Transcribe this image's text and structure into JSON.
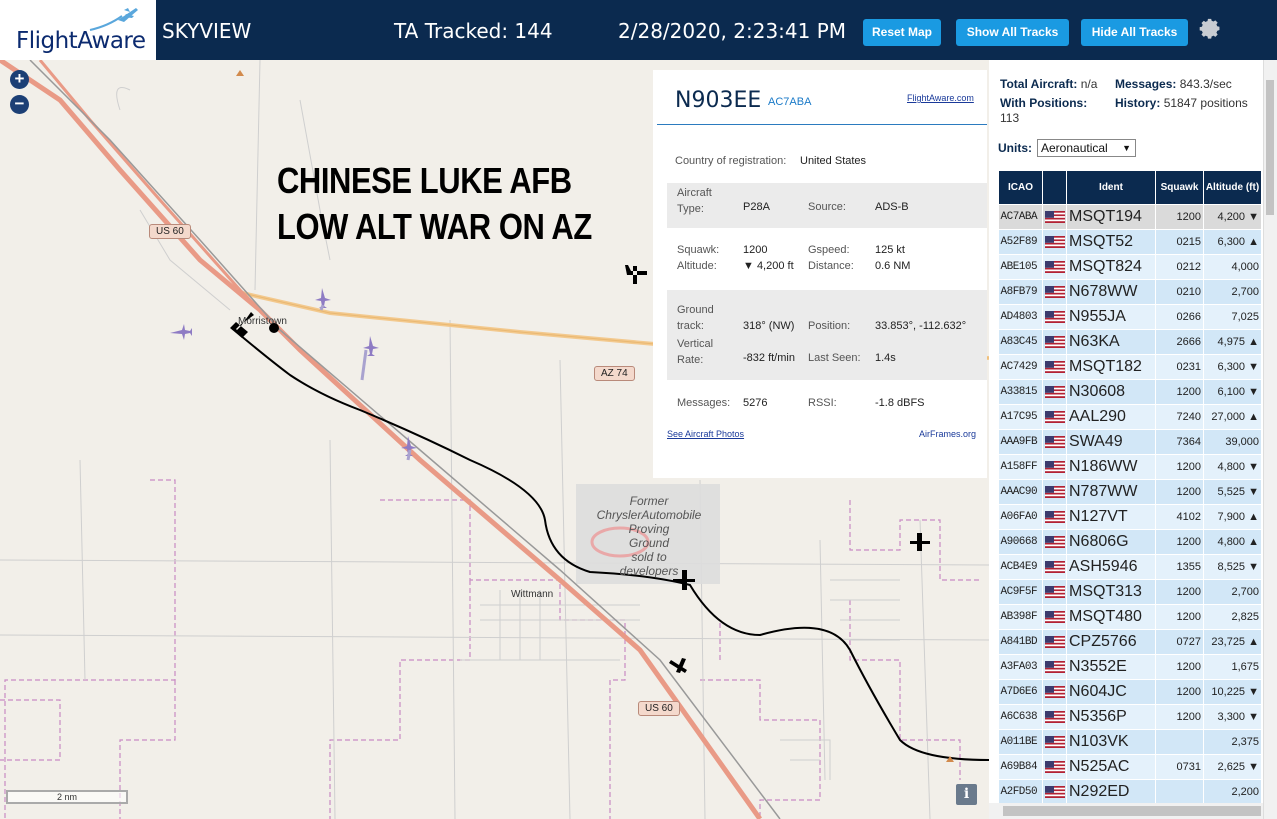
{
  "header": {
    "logo": "FlightAware",
    "app_title": "SKYVIEW",
    "ta_tracked": "TA Tracked: 144",
    "clock": "2/28/2020, 2:23:41 PM",
    "buttons": {
      "reset": "Reset Map",
      "show": "Show All Tracks",
      "hide": "Hide All Tracks"
    },
    "colors": {
      "header_bg": "#0b2a4f",
      "button_bg": "#1a9ae2"
    }
  },
  "map": {
    "zoom_in": "+",
    "zoom_out": "−",
    "overlay_text": [
      "CHINESE LUKE AFB",
      "LOW ALT WAR ON AZ"
    ],
    "place_labels": {
      "morristown": "Morristown",
      "wittmann": "Wittmann"
    },
    "roads": {
      "us60_a": "US 60",
      "us60_b": "US 60",
      "az74": "AZ 74"
    },
    "chrysler": [
      "Former",
      "ChryslerAutomobile",
      "Proving",
      "Ground",
      "sold to",
      "developers"
    ],
    "scale": "2 nm",
    "info": "i"
  },
  "detail": {
    "registration": "N903EE",
    "icao": "AC7ABA",
    "fa_link": "FlightAware.com",
    "country_label": "Country of registration:",
    "country": "United States",
    "aircraft_type_label": [
      "Aircraft",
      "Type:"
    ],
    "aircraft_type": "P28A",
    "source_label": "Source:",
    "source": "ADS-B",
    "squawk_label": "Squawk:",
    "squawk": "1200",
    "gspeed_label": "Gspeed:",
    "gspeed": "125 kt",
    "altitude_label": "Altitude:",
    "altitude": "▼ 4,200 ft",
    "distance_label": "Distance:",
    "distance": "0.6 NM",
    "track_label": [
      "Ground",
      "track:"
    ],
    "track": "318° (NW)",
    "position_label": "Position:",
    "position": "33.853°, -112.632°",
    "vrate_label": [
      "Vertical",
      "Rate:"
    ],
    "vrate": "-832 ft/min",
    "lastseen_label": "Last Seen:",
    "lastseen": "1.4s",
    "messages_label": "Messages:",
    "messages": "5276",
    "rssi_label": "RSSI:",
    "rssi": "-1.8 dBFS",
    "photos_link": "See Aircraft Photos",
    "airframes_link": "AirFrames.org"
  },
  "sidebar": {
    "total_label": "Total Aircraft:",
    "total": "n/a",
    "messages_label": "Messages:",
    "messages": "843.3/sec",
    "withpos_label": "With Positions:",
    "withpos": "113",
    "history_label": "History:",
    "history": "51847 positions",
    "units_label": "Units:",
    "units_value": "Aeronautical",
    "columns": [
      "ICAO",
      "",
      "Ident",
      "Squawk",
      "Altitude (ft)"
    ],
    "rows": [
      [
        "AC7ABA",
        "MSQT194",
        "1200",
        "4,200 ▼"
      ],
      [
        "A52F89",
        "MSQT52",
        "0215",
        "6,300 ▲"
      ],
      [
        "ABE105",
        "MSQT824",
        "0212",
        "4,000"
      ],
      [
        "A8FB79",
        "N678WW",
        "0210",
        "2,700"
      ],
      [
        "AD4803",
        "N955JA",
        "0266",
        "7,025"
      ],
      [
        "A83C45",
        "N63KA",
        "2666",
        "4,975 ▲"
      ],
      [
        "AC7429",
        "MSQT182",
        "0231",
        "6,300 ▼"
      ],
      [
        "A33815",
        "N30608",
        "1200",
        "6,100 ▼"
      ],
      [
        "A17C95",
        "AAL290",
        "7240",
        "27,000 ▲"
      ],
      [
        "AAA9FB",
        "SWA49",
        "7364",
        "39,000"
      ],
      [
        "A158FF",
        "N186WW",
        "1200",
        "4,800 ▼"
      ],
      [
        "AAAC90",
        "N787WW",
        "1200",
        "5,525 ▼"
      ],
      [
        "A06FA0",
        "N127VT",
        "4102",
        "7,900 ▲"
      ],
      [
        "A90668",
        "N6806G",
        "1200",
        "4,800 ▲"
      ],
      [
        "ACB4E9",
        "ASH5946",
        "1355",
        "8,525 ▼"
      ],
      [
        "AC9F5F",
        "MSQT313",
        "1200",
        "2,700"
      ],
      [
        "AB398F",
        "MSQT480",
        "1200",
        "2,825"
      ],
      [
        "A841BD",
        "CPZ5766",
        "0727",
        "23,725 ▲"
      ],
      [
        "A3FA03",
        "N3552E",
        "1200",
        "1,675"
      ],
      [
        "A7D6E6",
        "N604JC",
        "1200",
        "10,225 ▼"
      ],
      [
        "A6C638",
        "N5356P",
        "1200",
        "3,300 ▼"
      ],
      [
        "A011BE",
        "N103VK",
        "",
        "2,375"
      ],
      [
        "A69B84",
        "N525AC",
        "0731",
        "2,625 ▼"
      ],
      [
        "A2FD50",
        "N292ED",
        "",
        "2,200"
      ]
    ]
  }
}
